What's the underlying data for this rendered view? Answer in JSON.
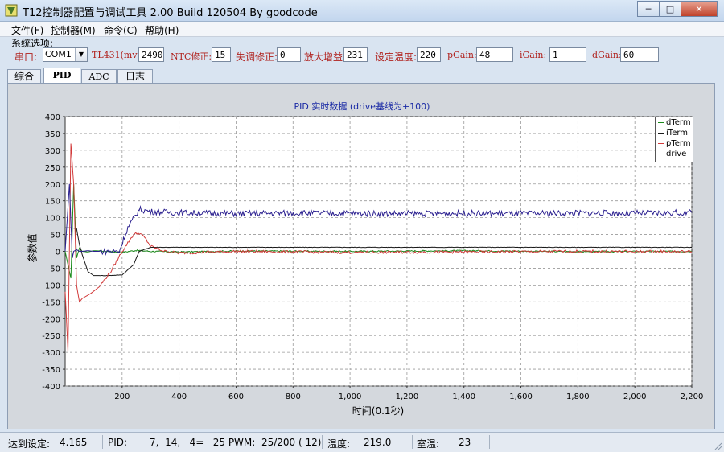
{
  "window": {
    "title": "T12控制器配置与调试工具 2.00 Build 120504 By goodcode",
    "minimize": "─",
    "maximize": "□",
    "close": "✕"
  },
  "menu": [
    "文件(F)",
    "控制器(M)",
    "命令(C)",
    "帮助(H)"
  ],
  "options_label": "系统选项:",
  "controls": {
    "port_label": "串口:",
    "port_value": "COM1",
    "tl431_label": "TL431(mv)",
    "tl431_value": "2490",
    "ntc_label": "NTC修正:",
    "ntc_value": "15",
    "offset_label": "失调修正:",
    "offset_value": "0",
    "gain_label": "放大增益:",
    "gain_value": "231",
    "settemp_label": "设定温度:",
    "settemp_value": "220",
    "pgain_label": "pGain:",
    "pgain_value": "48",
    "igain_label": "iGain:",
    "igain_value": "1",
    "dgain_label": "dGain:",
    "dgain_value": "60"
  },
  "tabs": [
    "综合",
    "PID",
    "ADC",
    "日志"
  ],
  "status": {
    "reach_label": "达到设定:",
    "reach_value": "4.165",
    "pid_label": "PID:",
    "pid_value": "7,  14,   4=   25 PWM:  25/200 ( 12)",
    "temp_label": "温度:",
    "temp_value": "219.0",
    "room_label": "室温:",
    "room_value": "23"
  },
  "colors": {
    "dTerm": "#1a8a1a",
    "iTerm": "#1a1a1a",
    "pTerm": "#d23a3a",
    "drive": "#2a1f8f"
  },
  "chart_data": {
    "type": "line",
    "title": "PID 实时数据 (drive基线为+100)",
    "xlabel": "时间(0.1秒)",
    "ylabel": "参数值",
    "xlim": [
      0,
      2200
    ],
    "ylim": [
      -400,
      400
    ],
    "xticks": [
      200,
      400,
      600,
      800,
      1000,
      1200,
      1400,
      1600,
      1800,
      2000,
      2200
    ],
    "xtick_labels": [
      "200",
      "400",
      "600",
      "800",
      "1,000",
      "1,200",
      "1,400",
      "1,600",
      "1,800",
      "2,000",
      "2,200"
    ],
    "yticks": [
      -400,
      -350,
      -300,
      -250,
      -200,
      -150,
      -100,
      -50,
      0,
      50,
      100,
      150,
      200,
      250,
      300,
      350,
      400
    ],
    "grid": true,
    "legend_position": "top-right",
    "series": [
      {
        "name": "dTerm",
        "x": [
          0,
          20,
          30,
          40,
          50,
          60,
          80,
          100,
          150,
          200,
          250,
          300,
          400,
          600,
          1000,
          1400,
          1800,
          2200
        ],
        "y": [
          0,
          -80,
          200,
          -20,
          10,
          0,
          -2,
          2,
          0,
          -3,
          3,
          0,
          -2,
          1,
          0,
          2,
          -1,
          0
        ]
      },
      {
        "name": "iTerm",
        "x": [
          0,
          20,
          40,
          50,
          60,
          80,
          100,
          150,
          200,
          240,
          260,
          300,
          400,
          1000,
          1600,
          2200
        ],
        "y": [
          70,
          70,
          68,
          20,
          -10,
          -60,
          -72,
          -72,
          -70,
          -40,
          0,
          12,
          12,
          12,
          12,
          12
        ]
      },
      {
        "name": "pTerm",
        "x": [
          0,
          10,
          20,
          30,
          35,
          40,
          50,
          60,
          70,
          90,
          120,
          160,
          200,
          240,
          260,
          280,
          300,
          350,
          400,
          600,
          1000,
          1400,
          1800,
          2200
        ],
        "y": [
          -120,
          -300,
          320,
          200,
          50,
          -100,
          -150,
          -140,
          -135,
          -125,
          -105,
          -60,
          0,
          50,
          55,
          40,
          15,
          0,
          -5,
          0,
          -3,
          -2,
          0,
          -1
        ]
      },
      {
        "name": "drive",
        "x": [
          0,
          15,
          25,
          30,
          40,
          50,
          60,
          80,
          100,
          150,
          190,
          220,
          250,
          260,
          300,
          400,
          600,
          800,
          1000,
          1200,
          1400,
          1600,
          1800,
          2000,
          2200
        ],
        "y": [
          0,
          200,
          -20,
          0,
          5,
          0,
          0,
          2,
          0,
          0,
          0,
          70,
          110,
          125,
          118,
          115,
          112,
          114,
          113,
          112,
          113,
          112,
          114,
          113,
          115
        ]
      }
    ]
  }
}
